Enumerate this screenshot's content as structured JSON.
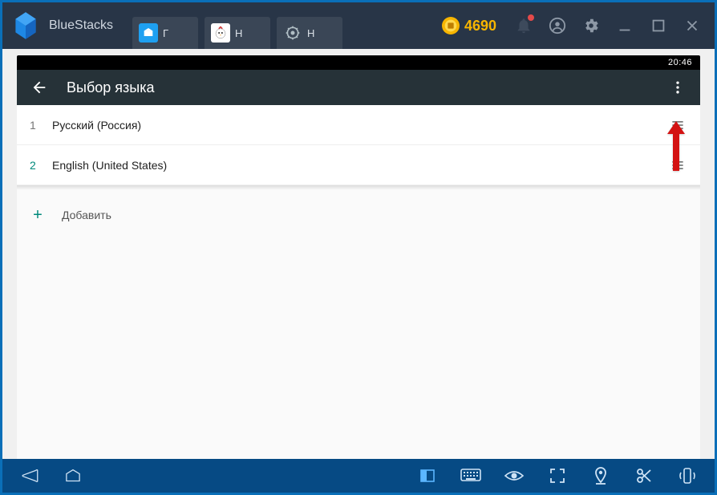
{
  "titlebar": {
    "brand": "BlueStacks",
    "tabs": [
      {
        "label": "Г",
        "icon_bg": "#1ea0f1"
      },
      {
        "label": "Н",
        "icon_bg": "#ffffff"
      },
      {
        "label": "Н",
        "icon_bg": "transparent"
      }
    ],
    "coin_amount": "4690"
  },
  "status_bar": {
    "time": "20:46"
  },
  "app_bar": {
    "title": "Выбор языка"
  },
  "languages": [
    {
      "num": "1",
      "name": "Русский (Россия)"
    },
    {
      "num": "2",
      "name": "English (United States)"
    }
  ],
  "add_row": {
    "plus": "+",
    "label": "Добавить"
  }
}
